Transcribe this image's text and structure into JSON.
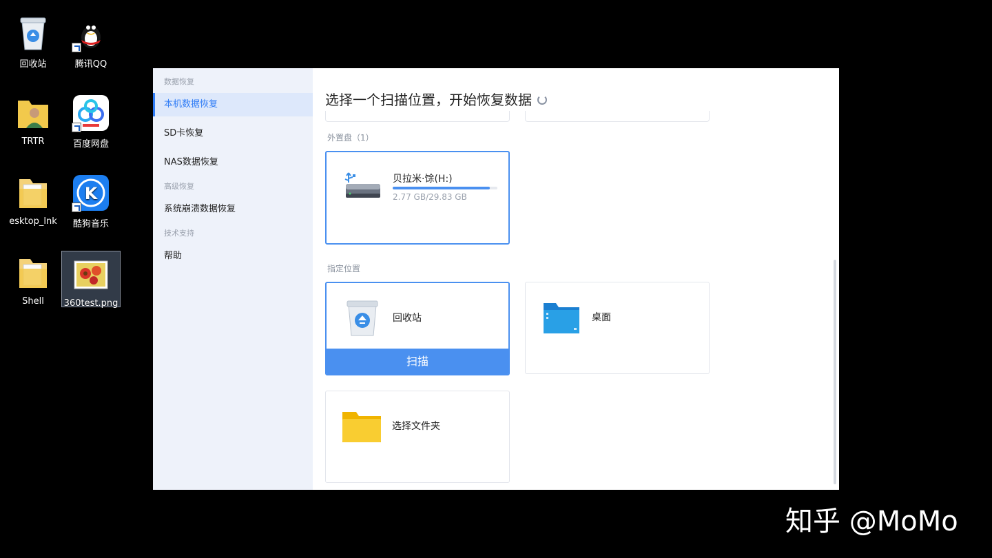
{
  "desktop": {
    "icons": [
      {
        "label": "回收站",
        "icon": "recycle-bin-icon"
      },
      {
        "label": "腾讯QQ",
        "icon": "qq-penguin-icon"
      },
      {
        "label": "TRTR",
        "icon": "user-folder-icon"
      },
      {
        "label": "百度网盘",
        "icon": "baidu-netdisk-icon"
      },
      {
        "label": "esktop_lnk",
        "icon": "folder-icon"
      },
      {
        "label": "酷狗音乐",
        "icon": "kugou-music-icon"
      },
      {
        "label": "Shell",
        "icon": "folder-icon"
      },
      {
        "label": "360test.png",
        "icon": "image-file-icon"
      }
    ]
  },
  "sidebar": {
    "groups": [
      {
        "label": "数据恢复",
        "items": [
          {
            "label": "本机数据恢复",
            "active": true
          },
          {
            "label": "SD卡恢复",
            "active": false
          },
          {
            "label": "NAS数据恢复",
            "active": false
          }
        ]
      },
      {
        "label": "高级恢复",
        "items": [
          {
            "label": "系统崩溃数据恢复",
            "active": false
          }
        ]
      },
      {
        "label": "技术支持",
        "items": [
          {
            "label": "帮助",
            "active": false
          }
        ]
      }
    ]
  },
  "main": {
    "title": "选择一个扫描位置，开始恢复数据",
    "external": {
      "label": "外置盘（1）",
      "drive": {
        "name": "贝拉米·馀(H:)",
        "usage": "2.77 GB/29.83 GB",
        "used_fraction": 0.93
      }
    },
    "locations": {
      "label": "指定位置",
      "recycle": {
        "name": "回收站",
        "button": "扫描"
      },
      "desktop": {
        "name": "桌面"
      },
      "folder": {
        "name": "选择文件夹"
      }
    }
  },
  "colors": {
    "accent": "#4a90f0",
    "sidebar_bg": "#eef2fa",
    "active_text": "#2f7cf6"
  },
  "watermark": "知乎 @MoMo"
}
